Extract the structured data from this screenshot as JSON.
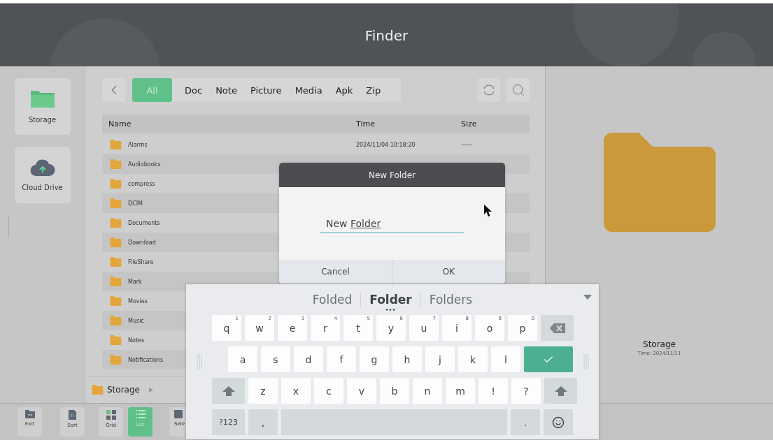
{
  "window": {
    "title": "Finder"
  },
  "sidebar": {
    "items": [
      {
        "label": "Storage",
        "kind": "storage"
      },
      {
        "label": "Cloud Drive",
        "kind": "cloud"
      }
    ]
  },
  "tabs": [
    {
      "label": "All",
      "selected": true
    },
    {
      "label": "Doc",
      "selected": false
    },
    {
      "label": "Note",
      "selected": false
    },
    {
      "label": "Picture",
      "selected": false
    },
    {
      "label": "Media",
      "selected": false
    },
    {
      "label": "Apk",
      "selected": false
    },
    {
      "label": "Zip",
      "selected": false
    }
  ],
  "table": {
    "columns": [
      "Name",
      "Time",
      "Size"
    ],
    "rows": [
      {
        "name": "Alarms",
        "time": "2024/11/04 10:18:20",
        "size": "——"
      },
      {
        "name": "Audiobooks"
      },
      {
        "name": "compress"
      },
      {
        "name": "DCIM"
      },
      {
        "name": "Documents"
      },
      {
        "name": "Download"
      },
      {
        "name": "FileShare"
      },
      {
        "name": "Mark"
      },
      {
        "name": "Movies"
      },
      {
        "name": "Music"
      },
      {
        "name": "Notes"
      },
      {
        "name": "Notifications"
      }
    ]
  },
  "breadcrumb": {
    "label": "Storage"
  },
  "preview": {
    "name": "Storage",
    "time": "Time: 2024/11/11"
  },
  "toolbar": [
    {
      "label": "Exit",
      "kind": "exit",
      "selected": false
    },
    {
      "label": "Sort",
      "kind": "sort",
      "selected": false
    },
    {
      "label": "Grid",
      "kind": "grid",
      "selected": false
    },
    {
      "label": "List",
      "kind": "list",
      "selected": true
    },
    {
      "label": "Sele",
      "kind": "select",
      "selected": false
    }
  ],
  "dialog": {
    "title": "New Folder",
    "value": "New",
    "composing": "Folder",
    "buttons": [
      "Cancel",
      "OK"
    ]
  },
  "keyboard": {
    "suggestions": [
      {
        "text": "Folded",
        "selected": false
      },
      {
        "text": "Folder",
        "selected": true
      },
      {
        "text": "Folders",
        "selected": false
      }
    ],
    "rows": [
      {
        "keys": [
          {
            "kind": "letter",
            "label": "q",
            "hint": "1"
          },
          {
            "kind": "letter",
            "label": "w",
            "hint": "2"
          },
          {
            "kind": "letter",
            "label": "e",
            "hint": "3"
          },
          {
            "kind": "letter",
            "label": "r",
            "hint": "4"
          },
          {
            "kind": "letter",
            "label": "t",
            "hint": "5"
          },
          {
            "kind": "letter",
            "label": "y",
            "hint": "6"
          },
          {
            "kind": "letter",
            "label": "u",
            "hint": "7"
          },
          {
            "kind": "letter",
            "label": "i",
            "hint": "8"
          },
          {
            "kind": "letter",
            "label": "o",
            "hint": "9"
          },
          {
            "kind": "letter",
            "label": "p",
            "hint": "0"
          },
          {
            "kind": "backspace"
          }
        ]
      },
      {
        "keys": [
          {
            "kind": "letter",
            "label": "a"
          },
          {
            "kind": "letter",
            "label": "s"
          },
          {
            "kind": "letter",
            "label": "d"
          },
          {
            "kind": "letter",
            "label": "f"
          },
          {
            "kind": "letter",
            "label": "g"
          },
          {
            "kind": "letter",
            "label": "h"
          },
          {
            "kind": "letter",
            "label": "j"
          },
          {
            "kind": "letter",
            "label": "k"
          },
          {
            "kind": "letter",
            "label": "l"
          },
          {
            "kind": "enter"
          }
        ]
      },
      {
        "keys": [
          {
            "kind": "shift"
          },
          {
            "kind": "letter",
            "label": "z"
          },
          {
            "kind": "letter",
            "label": "x"
          },
          {
            "kind": "letter",
            "label": "c"
          },
          {
            "kind": "letter",
            "label": "v"
          },
          {
            "kind": "letter",
            "label": "b"
          },
          {
            "kind": "letter",
            "label": "n"
          },
          {
            "kind": "letter",
            "label": "m"
          },
          {
            "kind": "letter",
            "label": "!"
          },
          {
            "kind": "letter",
            "label": "?"
          },
          {
            "kind": "shift"
          }
        ]
      },
      {
        "keys": [
          {
            "kind": "mode",
            "label": "?123"
          },
          {
            "kind": "symbol",
            "label": ","
          },
          {
            "kind": "space"
          },
          {
            "kind": "symbol",
            "label": "."
          },
          {
            "kind": "emoji"
          }
        ]
      }
    ]
  }
}
